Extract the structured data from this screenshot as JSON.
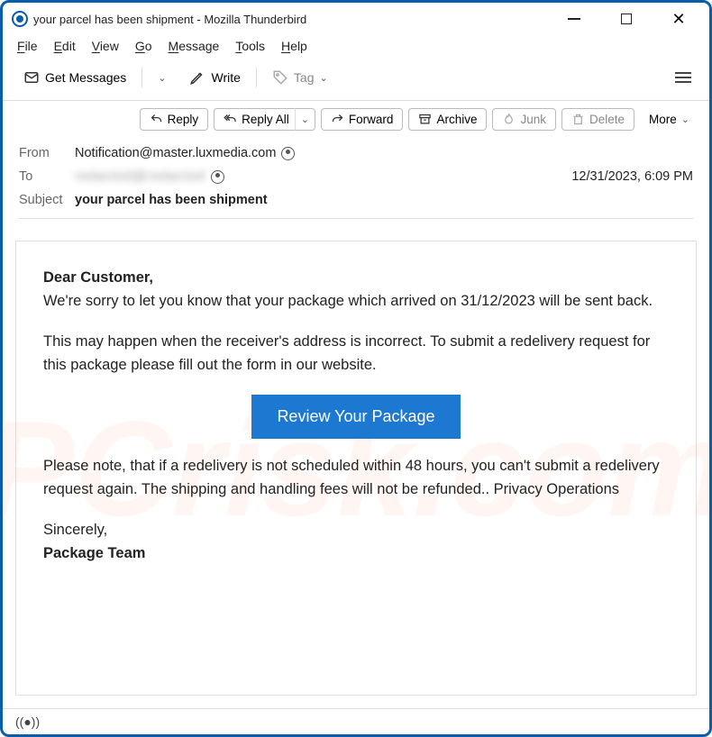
{
  "window": {
    "title": "your parcel has been shipment - Mozilla Thunderbird"
  },
  "menu": {
    "file": "File",
    "edit": "Edit",
    "view": "View",
    "go": "Go",
    "message": "Message",
    "tools": "Tools",
    "help": "Help"
  },
  "toolbar": {
    "get_messages": "Get Messages",
    "write": "Write",
    "tag": "Tag"
  },
  "actions": {
    "reply": "Reply",
    "reply_all": "Reply All",
    "forward": "Forward",
    "archive": "Archive",
    "junk": "Junk",
    "delete": "Delete",
    "more": "More"
  },
  "headers": {
    "from_label": "From",
    "from_value": "Notification@master.luxmedia.com",
    "to_label": "To",
    "to_value": "redacted@redacted",
    "date": "12/31/2023, 6:09 PM",
    "subject_label": "Subject",
    "subject_value": "your parcel has been shipment"
  },
  "body": {
    "greeting": "Dear Customer,",
    "p1": "We're sorry to let you know that your package which arrived on 31/12/2023 will be sent back.",
    "p2": "This may happen when the receiver's address is incorrect. To submit a redelivery request for this package please fill out the form in our website.",
    "cta": "Review Your Package",
    "p3": "Please note, that if a redelivery is not scheduled within 48 hours, you can't submit a redelivery request again. The shipping and handling fees will not be refunded.. Privacy Operations",
    "sincerely": "Sincerely,",
    "signature": "Package Team"
  },
  "status": {
    "icon": "((●))"
  },
  "watermark": "PCrisk.com"
}
